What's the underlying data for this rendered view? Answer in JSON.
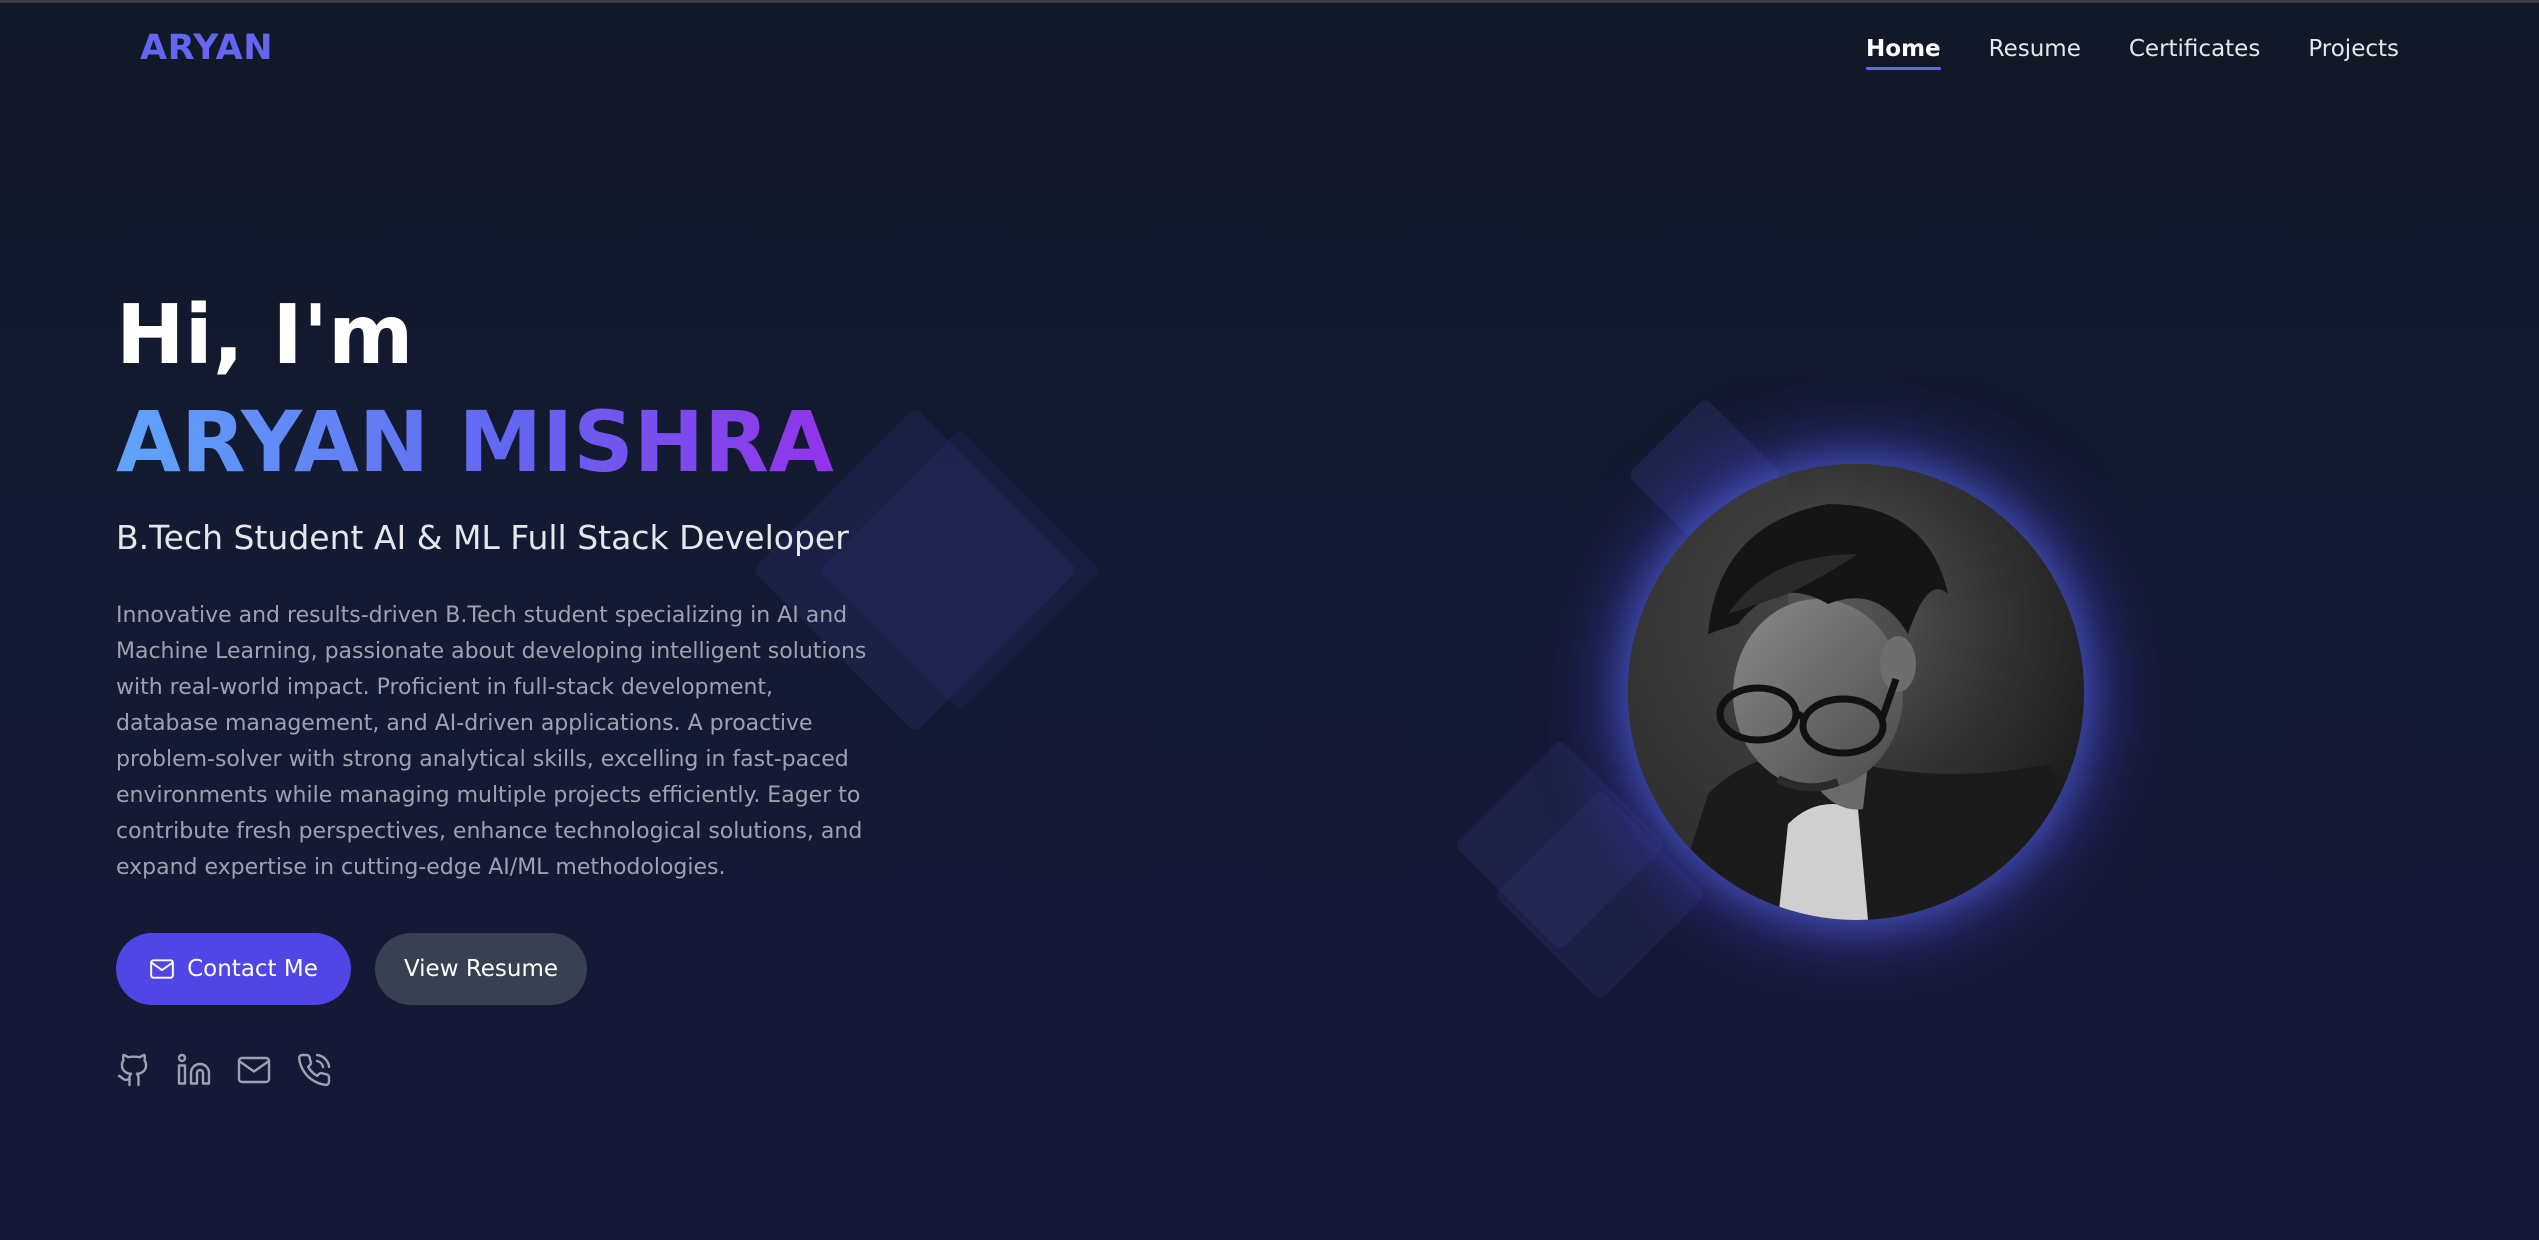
{
  "nav": {
    "logo": "ARYAN",
    "items": [
      {
        "label": "Home",
        "active": true
      },
      {
        "label": "Resume",
        "active": false
      },
      {
        "label": "Certificates",
        "active": false
      },
      {
        "label": "Projects",
        "active": false
      }
    ]
  },
  "hero": {
    "greeting": "Hi, I'm",
    "name": "ARYAN MISHRA",
    "role": "B.Tech Student AI & ML Full Stack Developer",
    "bio": "Innovative and results-driven B.Tech student specializing in AI and Machine Learning, passionate about developing intelligent solutions with real-world impact. Proficient in full-stack development, database management, and AI-driven applications. A proactive problem-solver with strong analytical skills, excelling in fast-paced environments while managing multiple projects efficiently. Eager to contribute fresh perspectives, enhance technological solutions, and expand expertise in cutting-edge AI/ML methodologies.",
    "buttons": {
      "contact": "Contact Me",
      "resume": "View Resume"
    },
    "socials": [
      {
        "icon": "github-icon"
      },
      {
        "icon": "linkedin-icon"
      },
      {
        "icon": "mail-icon"
      },
      {
        "icon": "phone-icon"
      }
    ]
  },
  "colors": {
    "accent": "#6366f1",
    "button_primary": "#4f46e5",
    "button_secondary": "#374151",
    "background": "#111827",
    "gradient_start": "#60a5fa",
    "gradient_end": "#9333ea"
  },
  "portrait": {
    "icon": "profile-photo"
  }
}
